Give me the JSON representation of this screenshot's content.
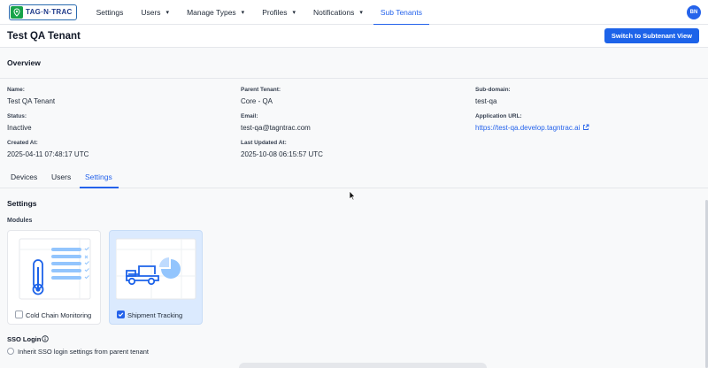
{
  "nav": {
    "logo_text": "TAG·N·TRAC",
    "items": [
      {
        "label": "Settings"
      },
      {
        "label": "Users",
        "chevron": "▾"
      },
      {
        "label": "Manage Types",
        "chevron": "▾"
      },
      {
        "label": "Profiles",
        "chevron": "▾"
      },
      {
        "label": "Notifications",
        "chevron": "▾"
      },
      {
        "label": "Sub Tenants"
      }
    ],
    "active": "Sub Tenants",
    "avatar_initials": "BN"
  },
  "header": {
    "title": "Test QA Tenant",
    "switch_button": "Switch to Subtenant View"
  },
  "overview": {
    "title": "Overview",
    "fields": {
      "name": {
        "label": "Name:",
        "value": "Test QA Tenant"
      },
      "parent_tenant": {
        "label": "Parent Tenant:",
        "value": "Core - QA"
      },
      "subdomain": {
        "label": "Sub-domain:",
        "value": "test-qa"
      },
      "status": {
        "label": "Status:",
        "value": "Inactive"
      },
      "email": {
        "label": "Email:",
        "value": "test-qa@tagntrac.com"
      },
      "app_url": {
        "label": "Application URL:",
        "value": "https://test-qa.develop.tagntrac.ai"
      },
      "created_at": {
        "label": "Created At:",
        "value": "2025-04-11 07:48:17 UTC"
      },
      "updated_at": {
        "label": "Last Updated At:",
        "value": "2025-10-08 06:15:57 UTC"
      }
    }
  },
  "tabs": [
    {
      "label": "Devices"
    },
    {
      "label": "Users"
    },
    {
      "label": "Settings"
    }
  ],
  "active_tab": "Settings",
  "settings": {
    "title": "Settings",
    "modules_title": "Modules",
    "modules": [
      {
        "label": "Cold Chain Monitoring",
        "checked": false,
        "icon": "thermometer-checklist-icon"
      },
      {
        "label": "Shipment Tracking",
        "checked": true,
        "icon": "truck-pie-icon"
      }
    ],
    "sso": {
      "title": "SSO Login",
      "inherit_label": "Inherit SSO login settings from parent tenant"
    }
  },
  "colors": {
    "accent": "#2563eb",
    "logo_green": "#16a34a",
    "selected_module_bg": "#dbeafe"
  }
}
